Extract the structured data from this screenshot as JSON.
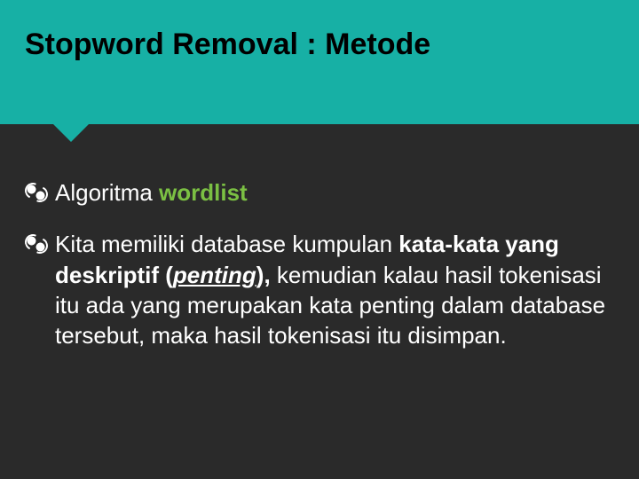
{
  "header": {
    "title": "Stopword Removal : Metode"
  },
  "bullets": [
    {
      "lead": "Algoritma ",
      "keyword": "wordlist",
      "rest": ""
    },
    {
      "lead": "Kita memiliki database kumpulan ",
      "bold1": "kata-kata yang  deskriptif (",
      "italic": "penting",
      "bold2": "),",
      "rest": " kemudian kalau hasil tokenisasi itu ada yang merupakan kata penting dalam database tersebut, maka hasil tokenisasi itu disimpan."
    }
  ]
}
